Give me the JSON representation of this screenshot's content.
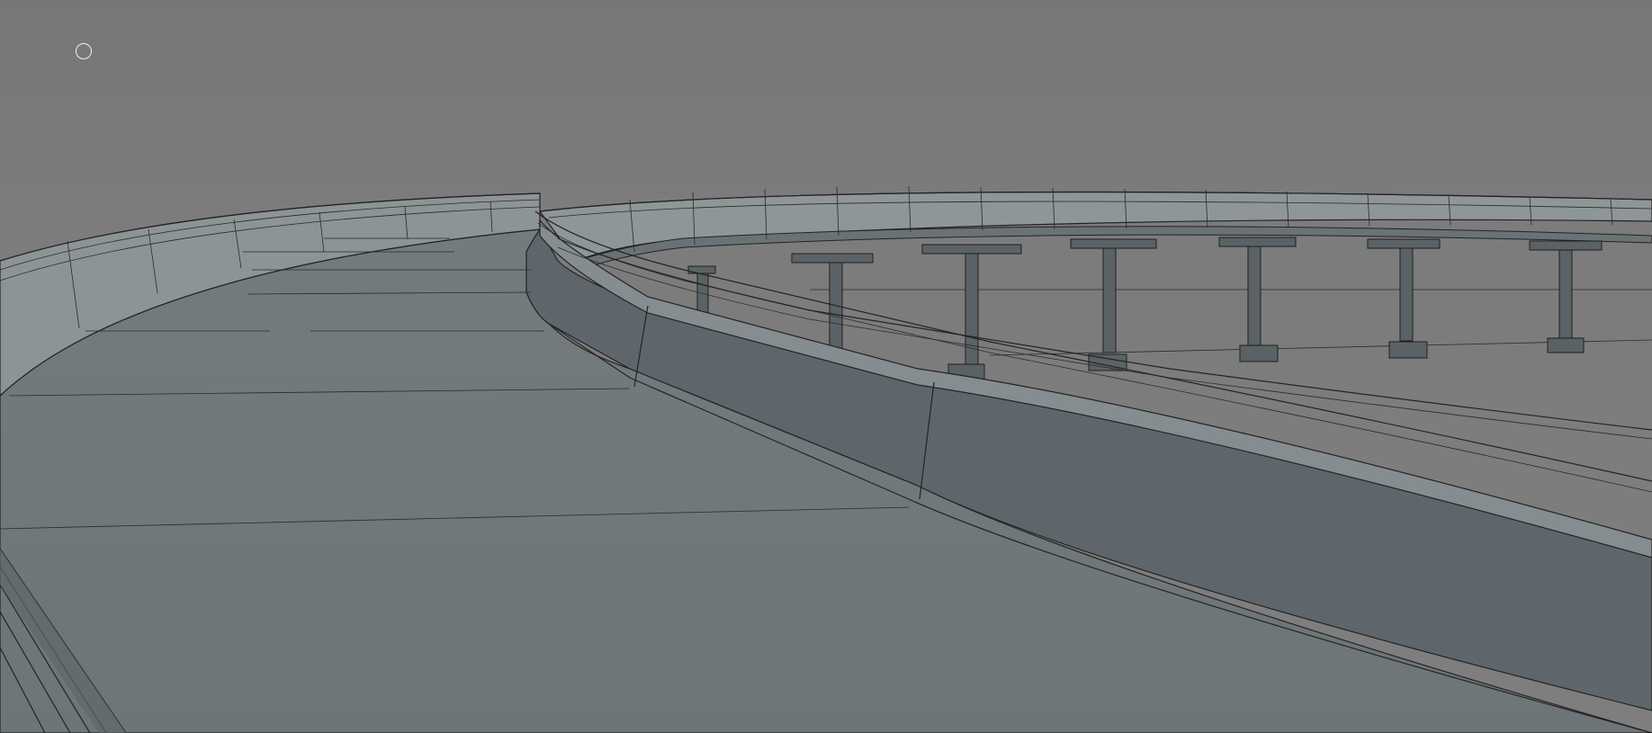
{
  "viewport": {
    "view_mode": "wireframe-on-shaded",
    "background_color": "#7b7b7b",
    "deck_color": "#6c7476",
    "barrier_inner_color": "#5e666c",
    "barrier_top_color": "#8a9294",
    "pillar_color": "#5a6266",
    "cursor_icon": "circle-cursor-icon"
  }
}
